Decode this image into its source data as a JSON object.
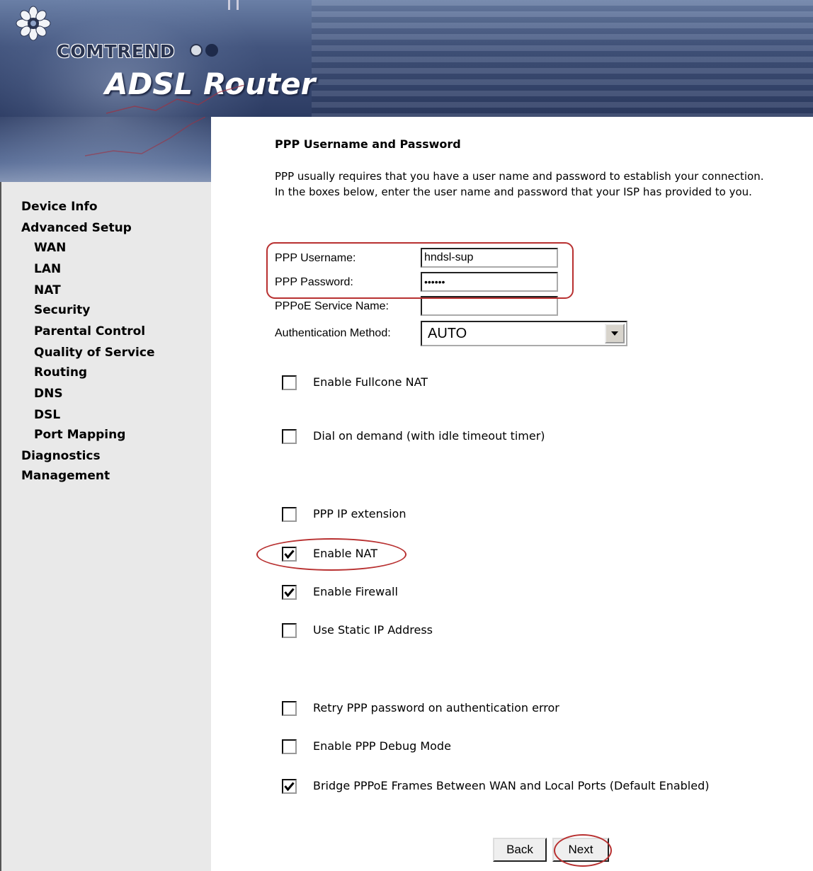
{
  "header": {
    "brand": "COMTREND",
    "product": "ADSL Router",
    "colors": {
      "banner_dark": "#2c3b62",
      "banner_light": "#6a7fa6",
      "brand_dot_light": "#d8dde6",
      "brand_dot_dark": "#1e2a4a"
    }
  },
  "sidebar": {
    "items": [
      {
        "label": "Device Info"
      },
      {
        "label": "Advanced Setup"
      },
      {
        "label": "WAN"
      },
      {
        "label": "LAN"
      },
      {
        "label": "NAT"
      },
      {
        "label": "Security"
      },
      {
        "label": "Parental Control"
      },
      {
        "label": "Quality of Service"
      },
      {
        "label": "Routing"
      },
      {
        "label": "DNS"
      },
      {
        "label": "DSL"
      },
      {
        "label": "Port Mapping"
      },
      {
        "label": "Diagnostics"
      },
      {
        "label": "Management"
      }
    ]
  },
  "main": {
    "title": "PPP Username and Password",
    "description": [
      "PPP usually requires that you have a user name and password to establish your connection.",
      "In the boxes below, enter the user name and password that your ISP has provided to you."
    ],
    "form": {
      "username_label": "PPP Username:",
      "username_value": "hndsl-sup",
      "password_label": "PPP Password:",
      "password_value": "••••••",
      "service_label": "PPPoE Service Name:",
      "service_value": "",
      "auth_label": "Authentication Method:",
      "auth_value": "AUTO"
    },
    "checkboxes": [
      {
        "label": "Enable Fullcone NAT",
        "checked": false
      },
      {
        "label": "Dial on demand (with idle timeout timer)",
        "checked": false
      },
      {
        "label": "PPP IP extension",
        "checked": false
      },
      {
        "label": "Enable NAT",
        "checked": true
      },
      {
        "label": "Enable Firewall",
        "checked": true
      },
      {
        "label": "Use Static IP Address",
        "checked": false
      },
      {
        "label": "Retry PPP password on authentication error",
        "checked": false
      },
      {
        "label": "Enable PPP Debug Mode",
        "checked": false
      },
      {
        "label": "Bridge PPPoE Frames Between WAN and Local Ports (Default Enabled)",
        "checked": true
      }
    ],
    "buttons": {
      "back": "Back",
      "next": "Next"
    },
    "highlight_color": "#b83030"
  }
}
